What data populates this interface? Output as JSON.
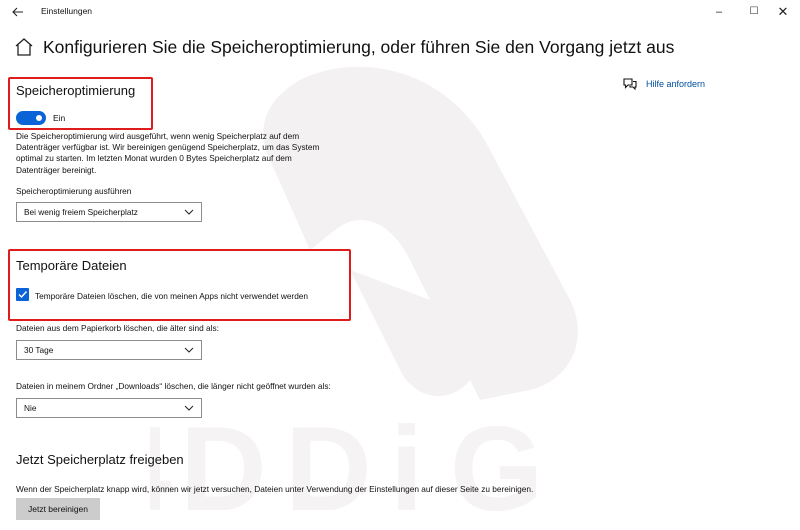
{
  "window": {
    "title": "Einstellungen",
    "back_icon": "arrow-left-icon",
    "minimize": "–",
    "maximize": "☐",
    "close": "✕"
  },
  "page": {
    "title": "Konfigurieren Sie die Speicheroptimierung, oder führen Sie den Vorgang jetzt aus"
  },
  "help": {
    "label": "Hilfe anfordern"
  },
  "storage_sense": {
    "heading": "Speicheroptimierung",
    "toggle_state": "Ein",
    "toggle_on": true,
    "description": "Die Speicheroptimierung wird ausgeführt, wenn wenig Speicherplatz auf dem Datenträger verfügbar ist. Wir bereinigen genügend Speicherplatz, um das System optimal zu starten. Im letzten Monat wurden 0 Bytes Speicherplatz auf dem Datenträger bereinigt.",
    "run_label": "Speicheroptimierung ausführen",
    "run_value": "Bei wenig freiem Speicherplatz"
  },
  "temp_files": {
    "heading": "Temporäre Dateien",
    "checkbox_label": "Temporäre Dateien löschen, die von meinen Apps nicht verwendet werden",
    "checked": true,
    "recycle_label": "Dateien aus dem Papierkorb löschen, die älter sind als:",
    "recycle_value": "30 Tage",
    "downloads_label": "Dateien in meinem Ordner „Downloads“ löschen, die länger nicht geöffnet wurden als:",
    "downloads_value": "Nie"
  },
  "free_now": {
    "heading": "Jetzt Speicherplatz freigeben",
    "description": "Wenn der Speicherplatz knapp wird, können wir jetzt versuchen, Dateien unter Verwendung der Einstellungen auf dieser Seite zu bereinigen.",
    "button": "Jetzt bereinigen"
  },
  "colors": {
    "accent": "#0a64d8",
    "highlight_box": "#e01b1b",
    "link": "#0050a0"
  }
}
